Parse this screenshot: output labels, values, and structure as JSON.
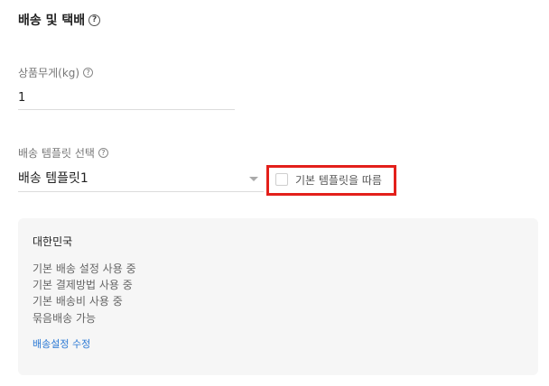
{
  "shipping": {
    "title": "배송 및 택배",
    "help": "?"
  },
  "weight": {
    "label": "상품무게(kg)",
    "help": "?",
    "value": "1"
  },
  "template": {
    "label": "배송 템플릿 선택",
    "help": "?",
    "selected": "배송 템플릿1",
    "checkbox_label": "기본 템플릿을 따름",
    "checkbox_checked": false
  },
  "panel": {
    "region": "대한민국",
    "lines": [
      "기본 배송 설정 사용 중",
      "기본 결제방법 사용 중",
      "기본 배송비 사용 중",
      "묶음배송 가능"
    ],
    "link": "배송설정 수정"
  },
  "colors": {
    "highlight": "#e3201b",
    "link": "#2a78d4",
    "panel_bg": "#f6f6f6"
  }
}
